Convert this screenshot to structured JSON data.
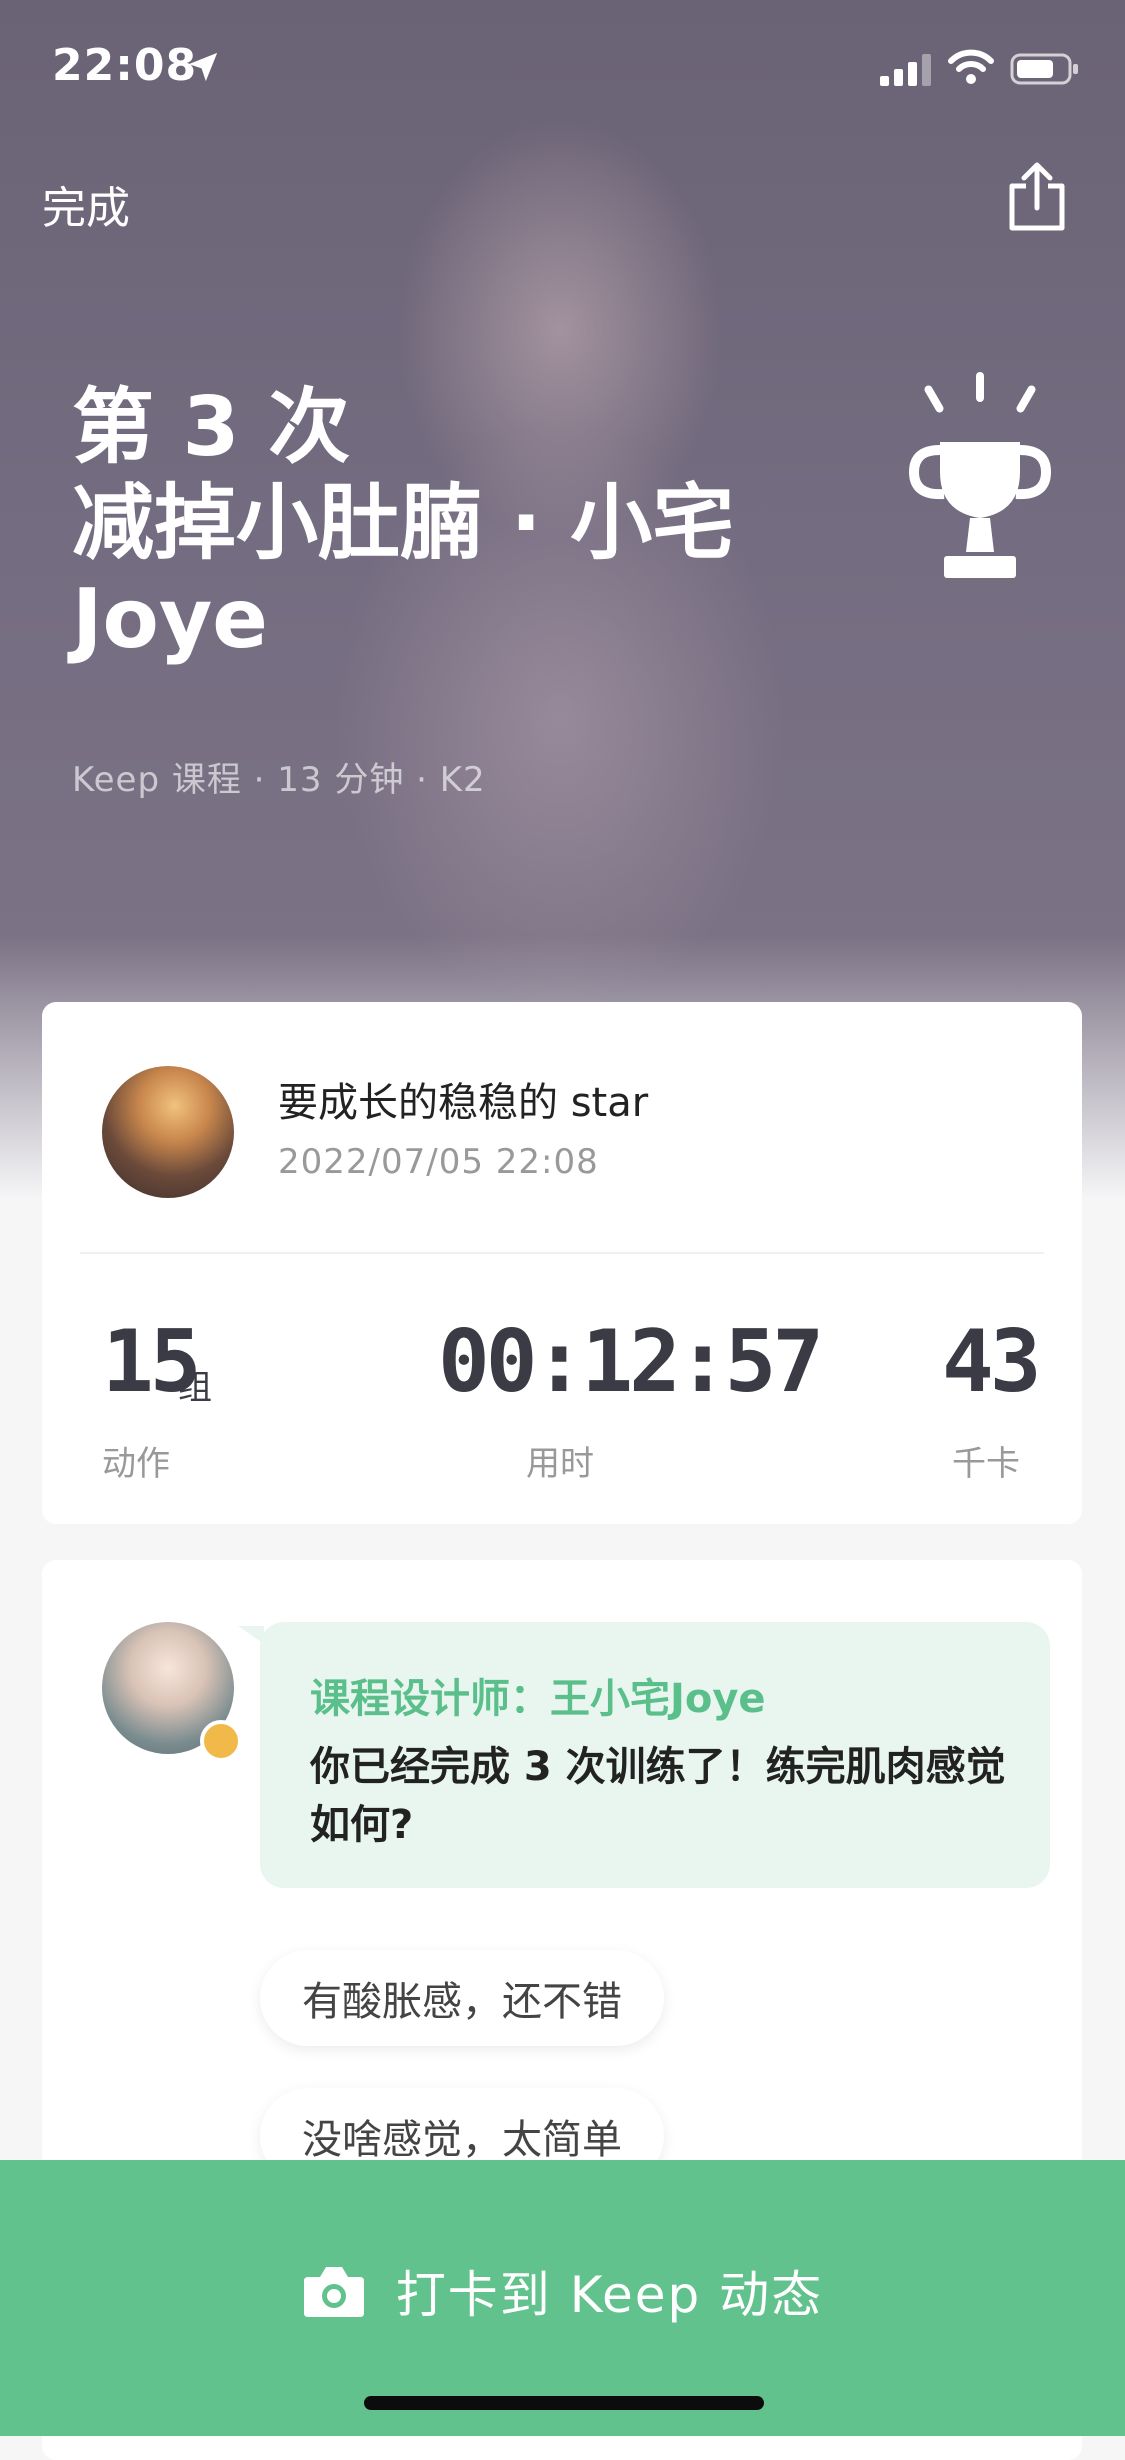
{
  "status_bar": {
    "time": "22:08"
  },
  "nav": {
    "done_label": "完成"
  },
  "hero": {
    "title_lines": [
      "第 3 次",
      "减掉小肚腩 · 小宅",
      "Joye"
    ],
    "meta": "Keep 课程 · 13 分钟 · K2"
  },
  "summary": {
    "user_name": "要成长的稳稳的 star",
    "datetime": "2022/07/05 22:08",
    "stats": [
      {
        "value": "15",
        "unit": "组",
        "label": "动作"
      },
      {
        "value": "00:12:57",
        "unit": "",
        "label": "用时"
      },
      {
        "value": "43",
        "unit": "",
        "label": "千卡"
      }
    ]
  },
  "feedback": {
    "coach_title": "课程设计师：王小宅Joye",
    "message": "你已经完成 3 次训练了！练完肌肉感觉如何?",
    "options": [
      "有酸胀感，还不错",
      "没啥感觉，太简单"
    ]
  },
  "cta": {
    "label": "打卡到 Keep 动态"
  },
  "colors": {
    "accent": "#62c28d",
    "accent_light": "#e8f6ef",
    "accent_text": "#5abf8a"
  }
}
